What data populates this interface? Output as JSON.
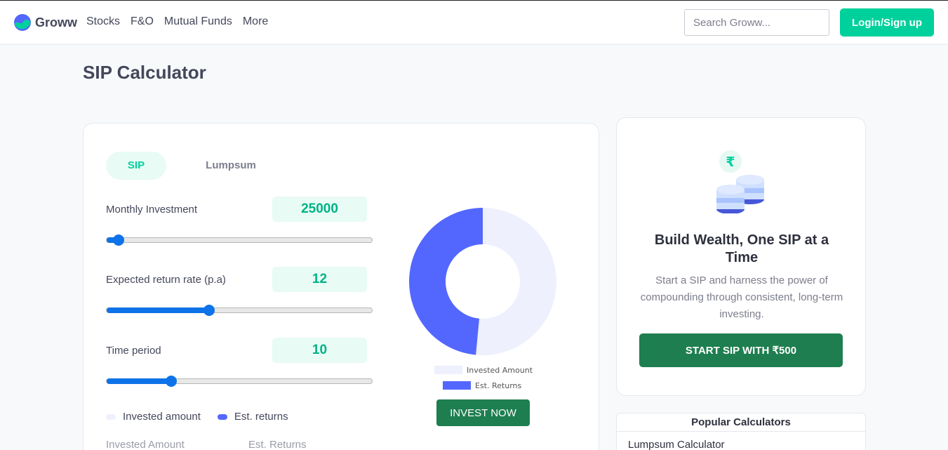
{
  "header": {
    "brand": "Groww",
    "nav": [
      "Stocks",
      "F&O",
      "Mutual Funds",
      "More"
    ],
    "search_placeholder": "Search Groww...",
    "login_label": "Login/Sign up"
  },
  "page_title": "SIP Calculator",
  "calculator": {
    "tabs": [
      {
        "label": "SIP",
        "active": true
      },
      {
        "label": "Lumpsum",
        "active": false
      }
    ],
    "inputs": [
      {
        "label": "Monthly Investment",
        "value": "25000",
        "slider_fraction": 0.045
      },
      {
        "label": "Expected return rate (p.a)",
        "value": "12",
        "slider_fraction": 0.385
      },
      {
        "label": "Time period",
        "value": "10",
        "slider_fraction": 0.243
      }
    ],
    "legend": {
      "invested": "Invested amount",
      "returns": "Est. returns"
    },
    "summary_labels": {
      "invested": "Invested Amount",
      "returns": "Est. Returns"
    },
    "invest_button": "INVEST NOW"
  },
  "chart_data": {
    "type": "pie",
    "style": "donut",
    "labels": [
      "Invested Amount",
      "Est. Returns"
    ],
    "values": [
      51.5,
      48.5
    ],
    "colors": [
      "#eef0fd",
      "#5367ff"
    ],
    "legend_position": "bottom"
  },
  "promo": {
    "icon": "rupee-coins-icon",
    "title": "Build Wealth, One SIP at a Time",
    "text": "Start a SIP and harness the power of compounding through consistent, long-term investing.",
    "button": "START SIP WITH ₹500"
  },
  "popular": {
    "title": "Popular Calculators",
    "items": [
      "Lumpsum Calculator"
    ]
  },
  "colors": {
    "brand_green": "#00d09c",
    "button_dark_green": "#1e7e4f",
    "slider_blue": "#0e73e8",
    "returns_blue": "#5367ff",
    "invested_light": "#eef0fd"
  }
}
